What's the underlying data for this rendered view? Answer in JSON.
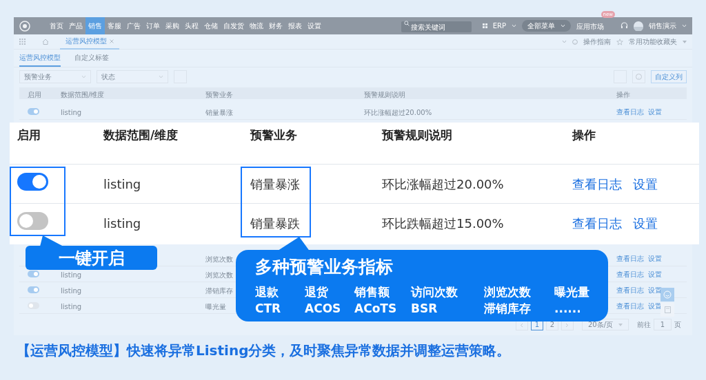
{
  "nav": {
    "items": [
      {
        "label": "首页",
        "selected": false
      },
      {
        "label": "产品",
        "selected": false
      },
      {
        "label": "销售",
        "selected": true
      },
      {
        "label": "客服",
        "selected": false
      },
      {
        "label": "广告",
        "selected": false
      },
      {
        "label": "订单",
        "selected": false
      },
      {
        "label": "采购",
        "selected": false
      },
      {
        "label": "头程",
        "selected": false
      },
      {
        "label": "仓储",
        "selected": false
      },
      {
        "label": "自发货",
        "selected": false
      },
      {
        "label": "物流",
        "selected": false
      },
      {
        "label": "财务",
        "selected": false
      },
      {
        "label": "报表",
        "selected": false
      },
      {
        "label": "设置",
        "selected": false
      }
    ],
    "search": {
      "placeholder": "搜索关键词"
    },
    "erp": "ERP",
    "all_menu": "全部菜单",
    "app_market": "应用市场",
    "new_badge": "new",
    "user": "销售演示"
  },
  "tab_bar": {
    "open_tab": "运营风控模型",
    "guide": "操作指南",
    "favorites": "常用功能收藏夹"
  },
  "sub_tabs": [
    {
      "label": "运营风控模型",
      "selected": true
    },
    {
      "label": "自定义标签",
      "selected": false
    }
  ],
  "filters": [
    {
      "placeholder": "预警业务"
    },
    {
      "placeholder": "状态"
    }
  ],
  "custom_columns": "自定义列",
  "columns": [
    "启用",
    "数据范围/维度",
    "预警业务",
    "预警规则说明",
    "操作"
  ],
  "rows": [
    {
      "on": true,
      "scope": "listing",
      "business": "销量暴涨",
      "rule": "环比涨幅超过20.00%",
      "actions": [
        "查看日志",
        "设置"
      ]
    },
    {
      "business": "浏览次数",
      "actions": [
        "查看日志",
        "设置"
      ]
    },
    {
      "on": true,
      "scope": "listing",
      "business": "浏览次数",
      "actions": [
        "查看日志",
        "设置"
      ]
    },
    {
      "on": true,
      "scope": "listing",
      "business": "滞销库存",
      "actions": [
        "查看日志",
        "设置"
      ]
    },
    {
      "on": false,
      "scope": "listing",
      "business": "曝光量",
      "actions": [
        "查看日志",
        "设置"
      ]
    }
  ],
  "pagination": {
    "pages": [
      {
        "label": "1",
        "selected": true
      },
      {
        "label": "2",
        "selected": false
      }
    ],
    "page_size": "20条/页",
    "goto": "前往",
    "page_input": "1",
    "page_unit": "页"
  },
  "zoom_table": {
    "columns": [
      "启用",
      "数据范围/维度",
      "预警业务",
      "预警规则说明",
      "操作"
    ],
    "rows": [
      {
        "on": true,
        "scope": "listing",
        "business": "销量暴涨",
        "rule": "环比涨幅超过20.00%",
        "actions": [
          "查看日志",
          "设置"
        ]
      },
      {
        "on": false,
        "scope": "listing",
        "business": "销量暴跌",
        "rule": "环比跌幅超过15.00%",
        "actions": [
          "查看日志",
          "设置"
        ]
      }
    ]
  },
  "callouts": {
    "toggle": "一键开启",
    "metrics_title": "多种预警业务指标",
    "metrics": [
      [
        "退款",
        "退货",
        "销售额",
        "访问次数",
        "浏览次数",
        "曝光量"
      ],
      [
        "CTR",
        "ACOS",
        "ACoTS",
        "BSR",
        "滞销库存",
        "......"
      ]
    ]
  },
  "caption": "【运营风控模型】快速将异常Listing分类，及时聚焦异常数据并调整运营策略。"
}
